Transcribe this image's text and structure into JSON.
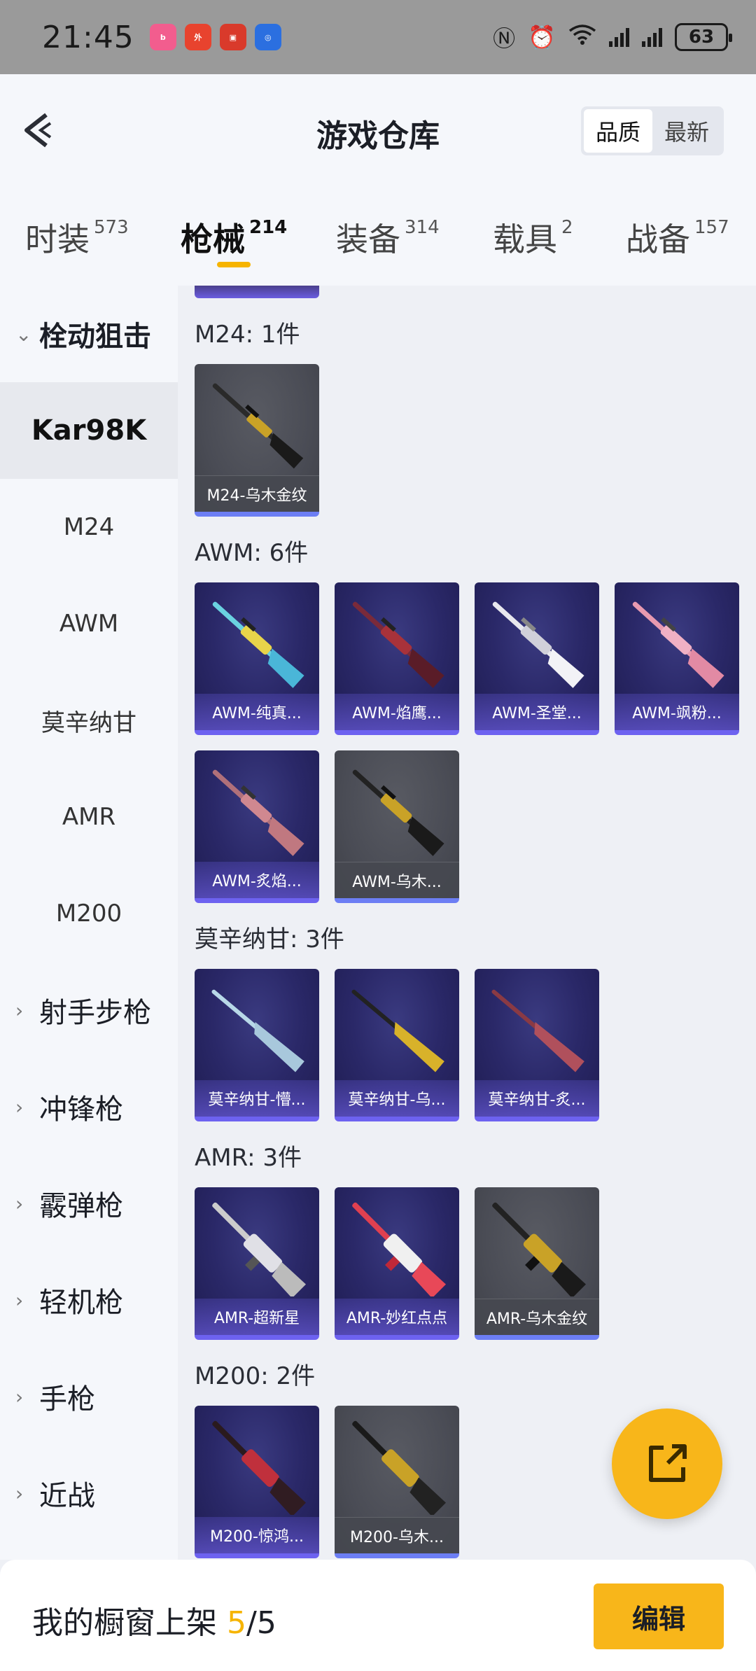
{
  "status_bar": {
    "time": "21:45",
    "battery": "63",
    "apps": [
      "bilibili-icon",
      "takeout-icon",
      "shop-icon",
      "safety-icon"
    ]
  },
  "header": {
    "title": "游戏仓库",
    "sort_options": [
      "品质",
      "最新"
    ],
    "selected_sort": "品质"
  },
  "categories": [
    {
      "name": "时装",
      "count": "573"
    },
    {
      "name": "枪械",
      "count": "214",
      "selected": true
    },
    {
      "name": "装备",
      "count": "314"
    },
    {
      "name": "载具",
      "count": "2"
    },
    {
      "name": "战备",
      "count": "157"
    }
  ],
  "sidebar": {
    "groups": [
      {
        "label": "栓动狙击",
        "open": true
      },
      {
        "label": "射手步枪"
      },
      {
        "label": "冲锋枪"
      },
      {
        "label": "霰弹枪"
      },
      {
        "label": "轻机枪"
      },
      {
        "label": "手枪"
      },
      {
        "label": "近战"
      }
    ],
    "subitems": [
      "Kar98K",
      "M24",
      "AWM",
      "莫辛纳甘",
      "AMR",
      "M200"
    ],
    "selected_subitem": "Kar98K"
  },
  "sections": [
    {
      "title": "M24: 1件",
      "items": [
        {
          "name": "M24-乌木金纹",
          "style": "gray"
        }
      ]
    },
    {
      "title": "AWM: 6件",
      "items": [
        {
          "name": "AWM-纯真...",
          "style": "purple"
        },
        {
          "name": "AWM-焰鹰...",
          "style": "purple"
        },
        {
          "name": "AWM-圣堂...",
          "style": "purple"
        },
        {
          "name": "AWM-飒粉...",
          "style": "purple"
        },
        {
          "name": "AWM-炙焰...",
          "style": "purple"
        },
        {
          "name": "AWM-乌木...",
          "style": "gray"
        }
      ]
    },
    {
      "title": "莫辛纳甘: 3件",
      "items": [
        {
          "name": "莫辛纳甘-懵...",
          "style": "purple"
        },
        {
          "name": "莫辛纳甘-乌...",
          "style": "purple"
        },
        {
          "name": "莫辛纳甘-炙...",
          "style": "purple"
        }
      ]
    },
    {
      "title": "AMR: 3件",
      "items": [
        {
          "name": "AMR-超新星",
          "style": "purple"
        },
        {
          "name": "AMR-妙红点点",
          "style": "purple"
        },
        {
          "name": "AMR-乌木金纹",
          "style": "gray"
        }
      ]
    },
    {
      "title": "M200: 2件",
      "items": [
        {
          "name": "M200-惊鸿...",
          "style": "purple"
        },
        {
          "name": "M200-乌木...",
          "style": "gray"
        }
      ]
    }
  ],
  "bottom_bar": {
    "label": "我的橱窗上架 ",
    "current": "5",
    "separator": "/",
    "total": "5",
    "edit_button": "编辑"
  },
  "colors": {
    "accent": "#f8b61a",
    "card_purple": "#2a2868",
    "card_gray": "#4a4c55"
  }
}
